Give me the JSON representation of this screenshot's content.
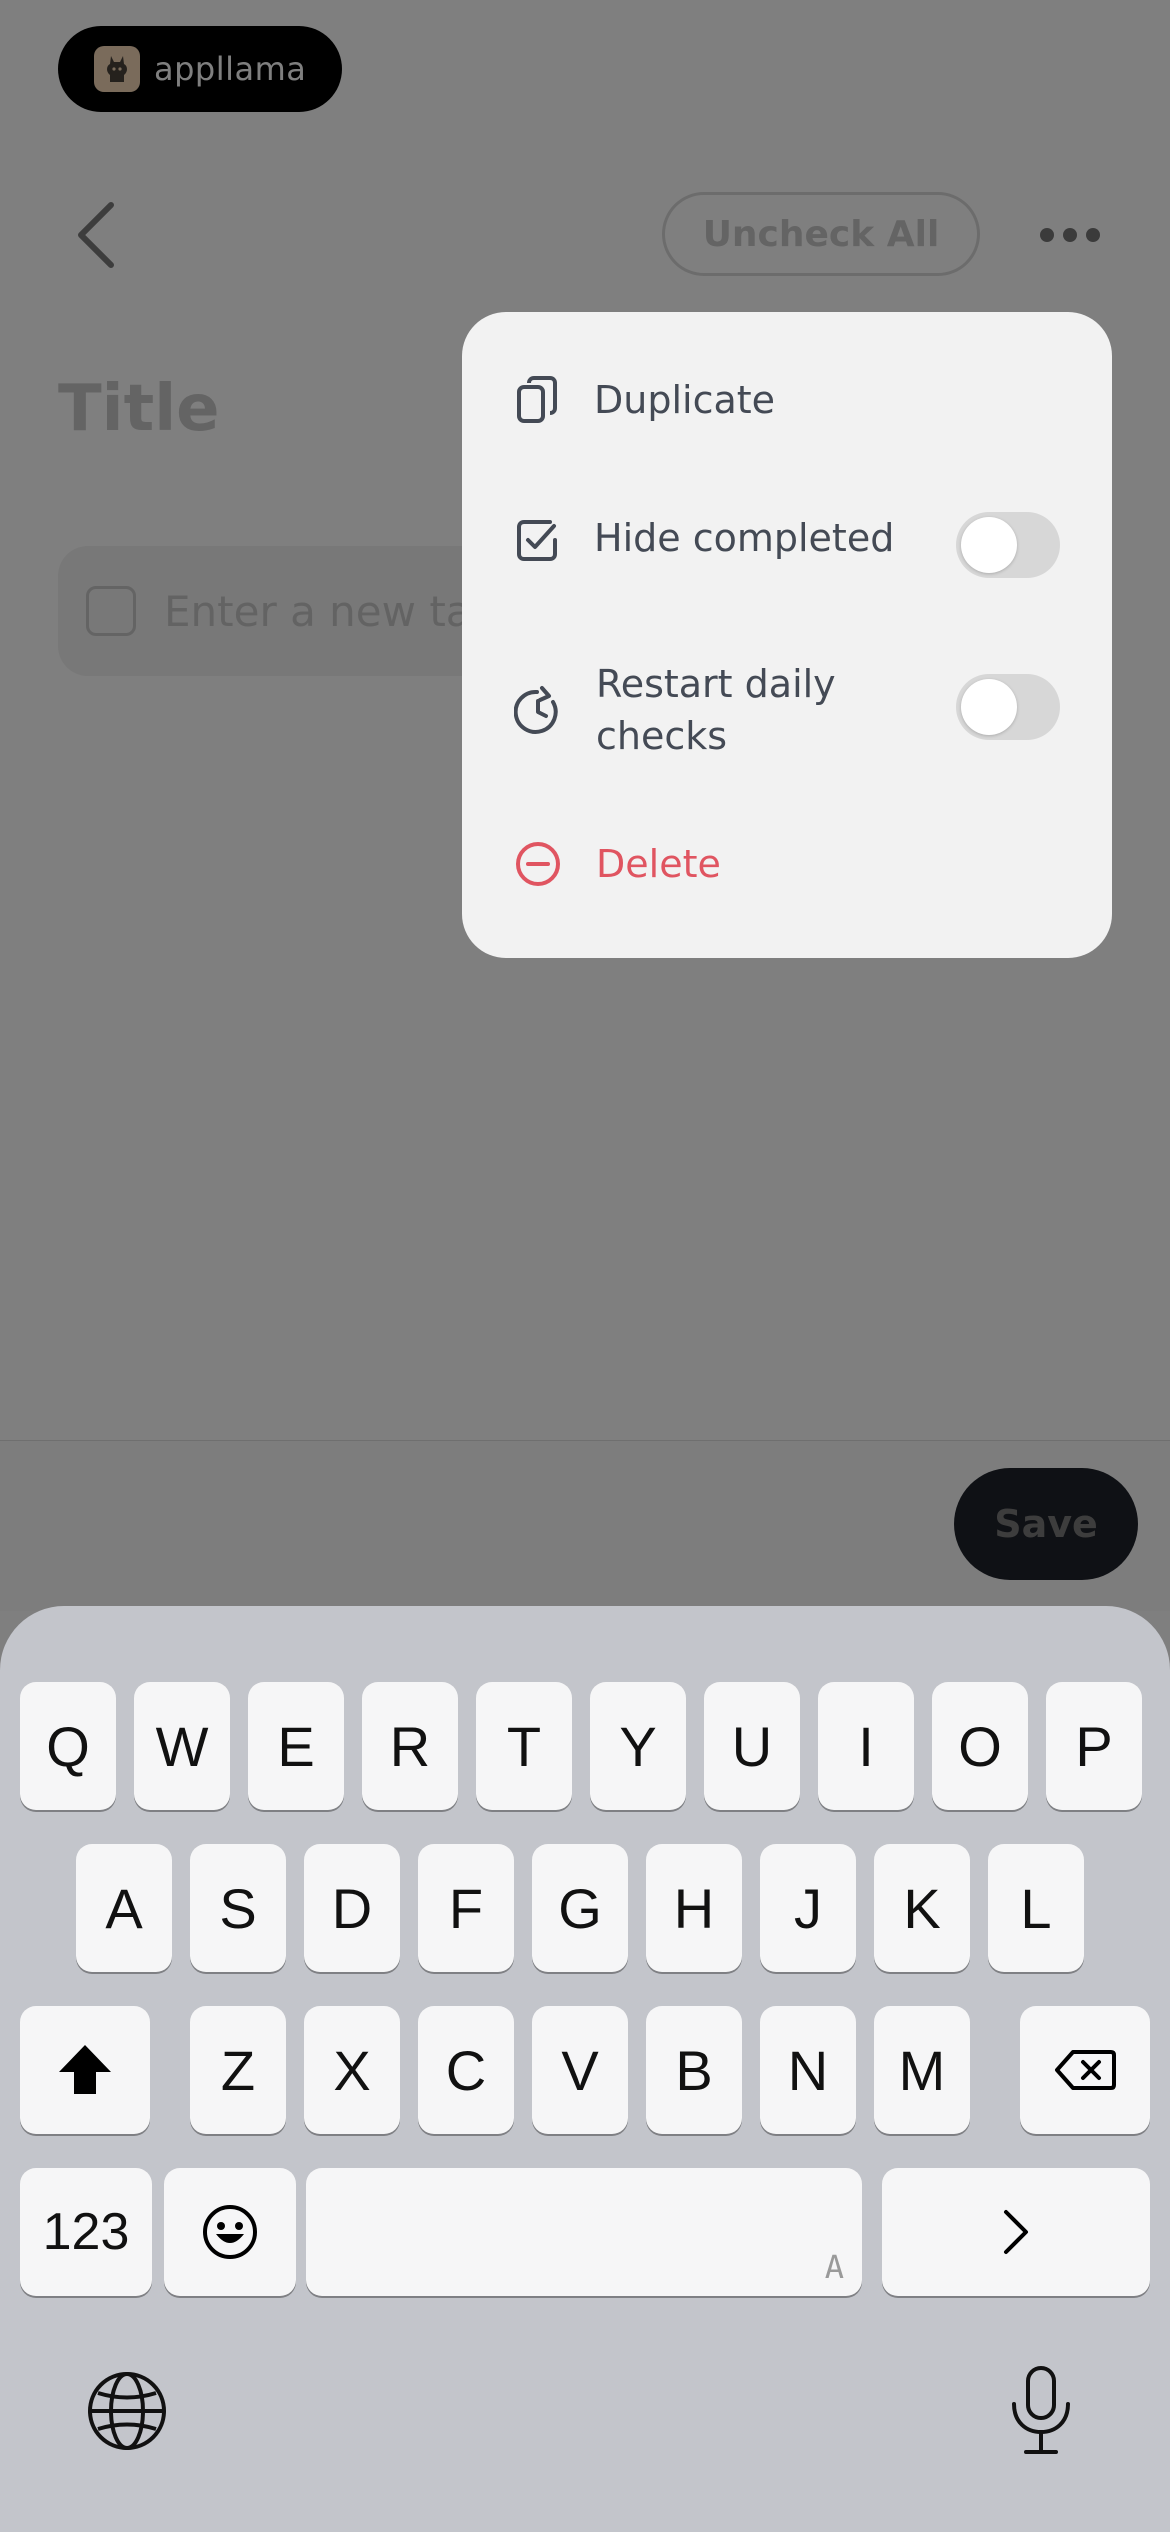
{
  "header": {
    "logo_text": "appllama",
    "uncheck_all_label": "Uncheck All"
  },
  "editor": {
    "title_placeholder": "Title",
    "task_placeholder": "Enter a new ta"
  },
  "actions": {
    "save_label": "Save"
  },
  "menu": {
    "items": [
      {
        "label": "Duplicate",
        "icon": "duplicate-icon"
      },
      {
        "label": "Hide completed",
        "icon": "check-square-icon",
        "toggle": false
      },
      {
        "label": "Restart daily checks",
        "icon": "restart-clock-icon",
        "toggle": false
      },
      {
        "label": "Delete",
        "icon": "minus-circle-icon",
        "color": "#e05561"
      }
    ]
  },
  "keyboard": {
    "row1": [
      "Q",
      "W",
      "E",
      "R",
      "T",
      "Y",
      "U",
      "I",
      "O",
      "P"
    ],
    "row2": [
      "A",
      "S",
      "D",
      "F",
      "G",
      "H",
      "J",
      "K",
      "L"
    ],
    "row3": [
      "Z",
      "X",
      "C",
      "V",
      "B",
      "N",
      "M"
    ],
    "numbers_label": "123",
    "space_hint": "A"
  },
  "colors": {
    "dim_overlay": "#7f7f7f",
    "delete_red": "#e05561",
    "save_button_bg": "#1f232b"
  }
}
